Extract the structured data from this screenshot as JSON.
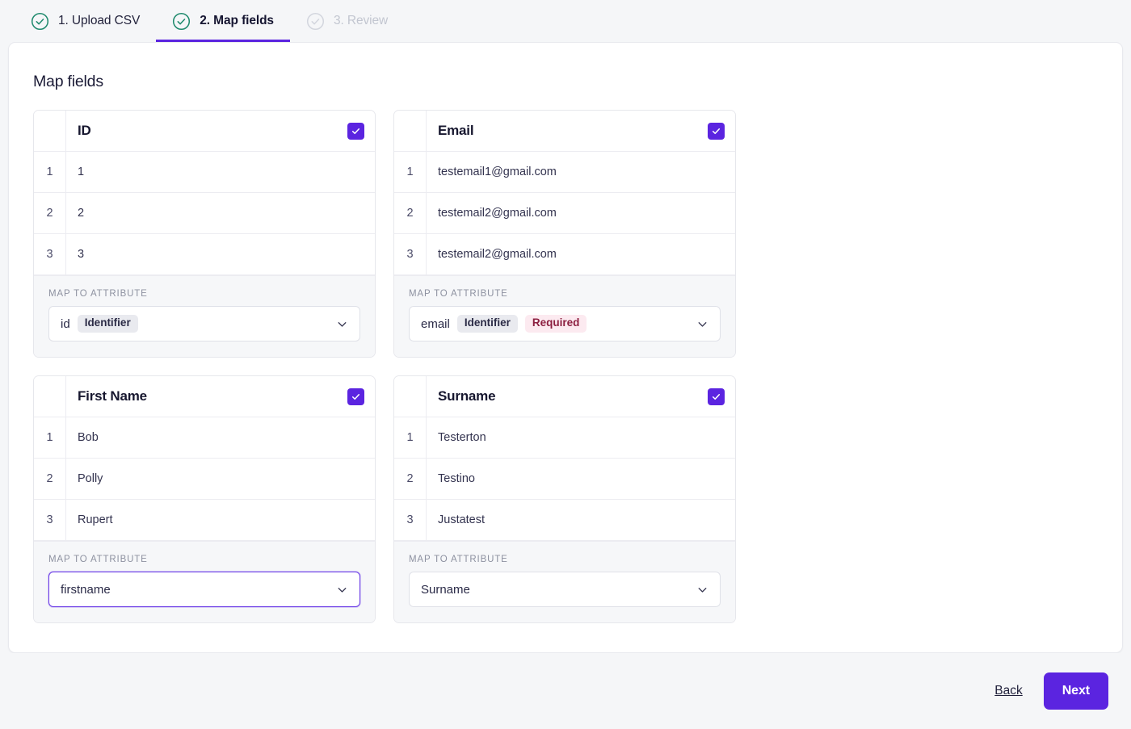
{
  "stepper": {
    "steps": [
      {
        "label": "1. Upload CSV",
        "state": "done",
        "icon": "check-circle-icon"
      },
      {
        "label": "2. Map fields",
        "state": "active",
        "icon": "check-circle-icon"
      },
      {
        "label": "3. Review",
        "state": "disabled",
        "icon": "check-circle-icon"
      }
    ]
  },
  "main": {
    "title": "Map fields",
    "map_to_attribute_label": "MAP TO ATTRIBUTE",
    "columns": [
      {
        "header": "ID",
        "checked": true,
        "rows": [
          {
            "num": "1",
            "value": "1"
          },
          {
            "num": "2",
            "value": "2"
          },
          {
            "num": "3",
            "value": "3"
          }
        ],
        "select": {
          "value": "id",
          "tags": [
            {
              "text": "Identifier",
              "kind": "identifier"
            }
          ],
          "focused": false
        }
      },
      {
        "header": "Email",
        "checked": true,
        "rows": [
          {
            "num": "1",
            "value": "testemail1@gmail.com"
          },
          {
            "num": "2",
            "value": "testemail2@gmail.com"
          },
          {
            "num": "3",
            "value": "testemail2@gmail.com"
          }
        ],
        "select": {
          "value": "email",
          "tags": [
            {
              "text": "Identifier",
              "kind": "identifier"
            },
            {
              "text": "Required",
              "kind": "required"
            }
          ],
          "focused": false
        }
      },
      {
        "header": "First Name",
        "checked": true,
        "rows": [
          {
            "num": "1",
            "value": "Bob"
          },
          {
            "num": "2",
            "value": "Polly"
          },
          {
            "num": "3",
            "value": "Rupert"
          }
        ],
        "select": {
          "value": "firstname",
          "tags": [],
          "focused": true
        }
      },
      {
        "header": "Surname",
        "checked": true,
        "rows": [
          {
            "num": "1",
            "value": "Testerton"
          },
          {
            "num": "2",
            "value": "Testino"
          },
          {
            "num": "3",
            "value": "Justatest"
          }
        ],
        "select": {
          "value": "Surname",
          "tags": [],
          "focused": false
        }
      }
    ]
  },
  "footer": {
    "back_label": "Back",
    "next_label": "Next"
  },
  "colors": {
    "accent": "#5b24e0",
    "step_done": "#1f8a6d",
    "step_disabled": "#c2c6d0",
    "required_bg": "#fceaf0",
    "required_text": "#8c1f40",
    "identifier_bg": "#e9eaef",
    "page_bg": "#f5f6f8"
  }
}
